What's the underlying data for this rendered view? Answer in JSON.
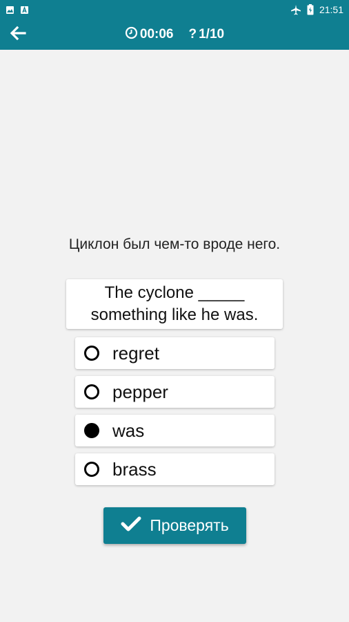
{
  "status_bar": {
    "time": "21:51",
    "left_icons": [
      "image-icon",
      "notification-a-icon"
    ],
    "right_icons": [
      "airplane-icon",
      "battery-icon"
    ]
  },
  "app_bar": {
    "back_icon": "arrow-left-icon",
    "timer_icon": "clock-icon",
    "timer": "00:06",
    "question_icon": "question-mark-icon",
    "question_mark": "?",
    "progress": "1/10"
  },
  "quiz": {
    "prompt": "Циклон был чем-то вроде него.",
    "sentence_line1": "The cyclone _____",
    "sentence_line2": "something like he was.",
    "options": [
      {
        "label": "regret",
        "selected": false
      },
      {
        "label": "pepper",
        "selected": false
      },
      {
        "label": "was",
        "selected": true
      },
      {
        "label": "brass",
        "selected": false
      }
    ]
  },
  "check_button": {
    "icon": "checkmark-icon",
    "label": "Проверять"
  },
  "colors": {
    "accent": "#0f7f91",
    "background": "#f2f2f2"
  }
}
